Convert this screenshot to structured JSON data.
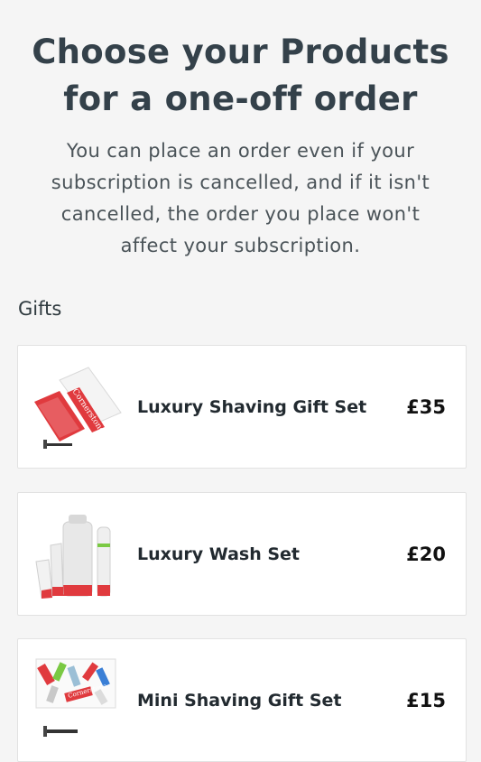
{
  "header": {
    "title_line1": "Choose your Products",
    "title_line2": "for a one-off order",
    "subtitle_lines": [
      "You can place an order even if your",
      "subscription is cancelled, and if it isn't",
      "cancelled, the order you place won't",
      "affect your subscription."
    ]
  },
  "section": {
    "label": "Gifts"
  },
  "products": [
    {
      "name": "Luxury Shaving Gift Set",
      "price": "£35",
      "brand_text": "Cornerstone"
    },
    {
      "name": "Luxury Wash Set",
      "price": "£20"
    },
    {
      "name": "Mini Shaving Gift Set",
      "price": "£15",
      "brand_text": "Cornerstone"
    }
  ],
  "colors": {
    "background": "#f5f5f5",
    "card": "#ffffff",
    "brand_red": "#e03a3e",
    "text_dark": "#34414a"
  }
}
